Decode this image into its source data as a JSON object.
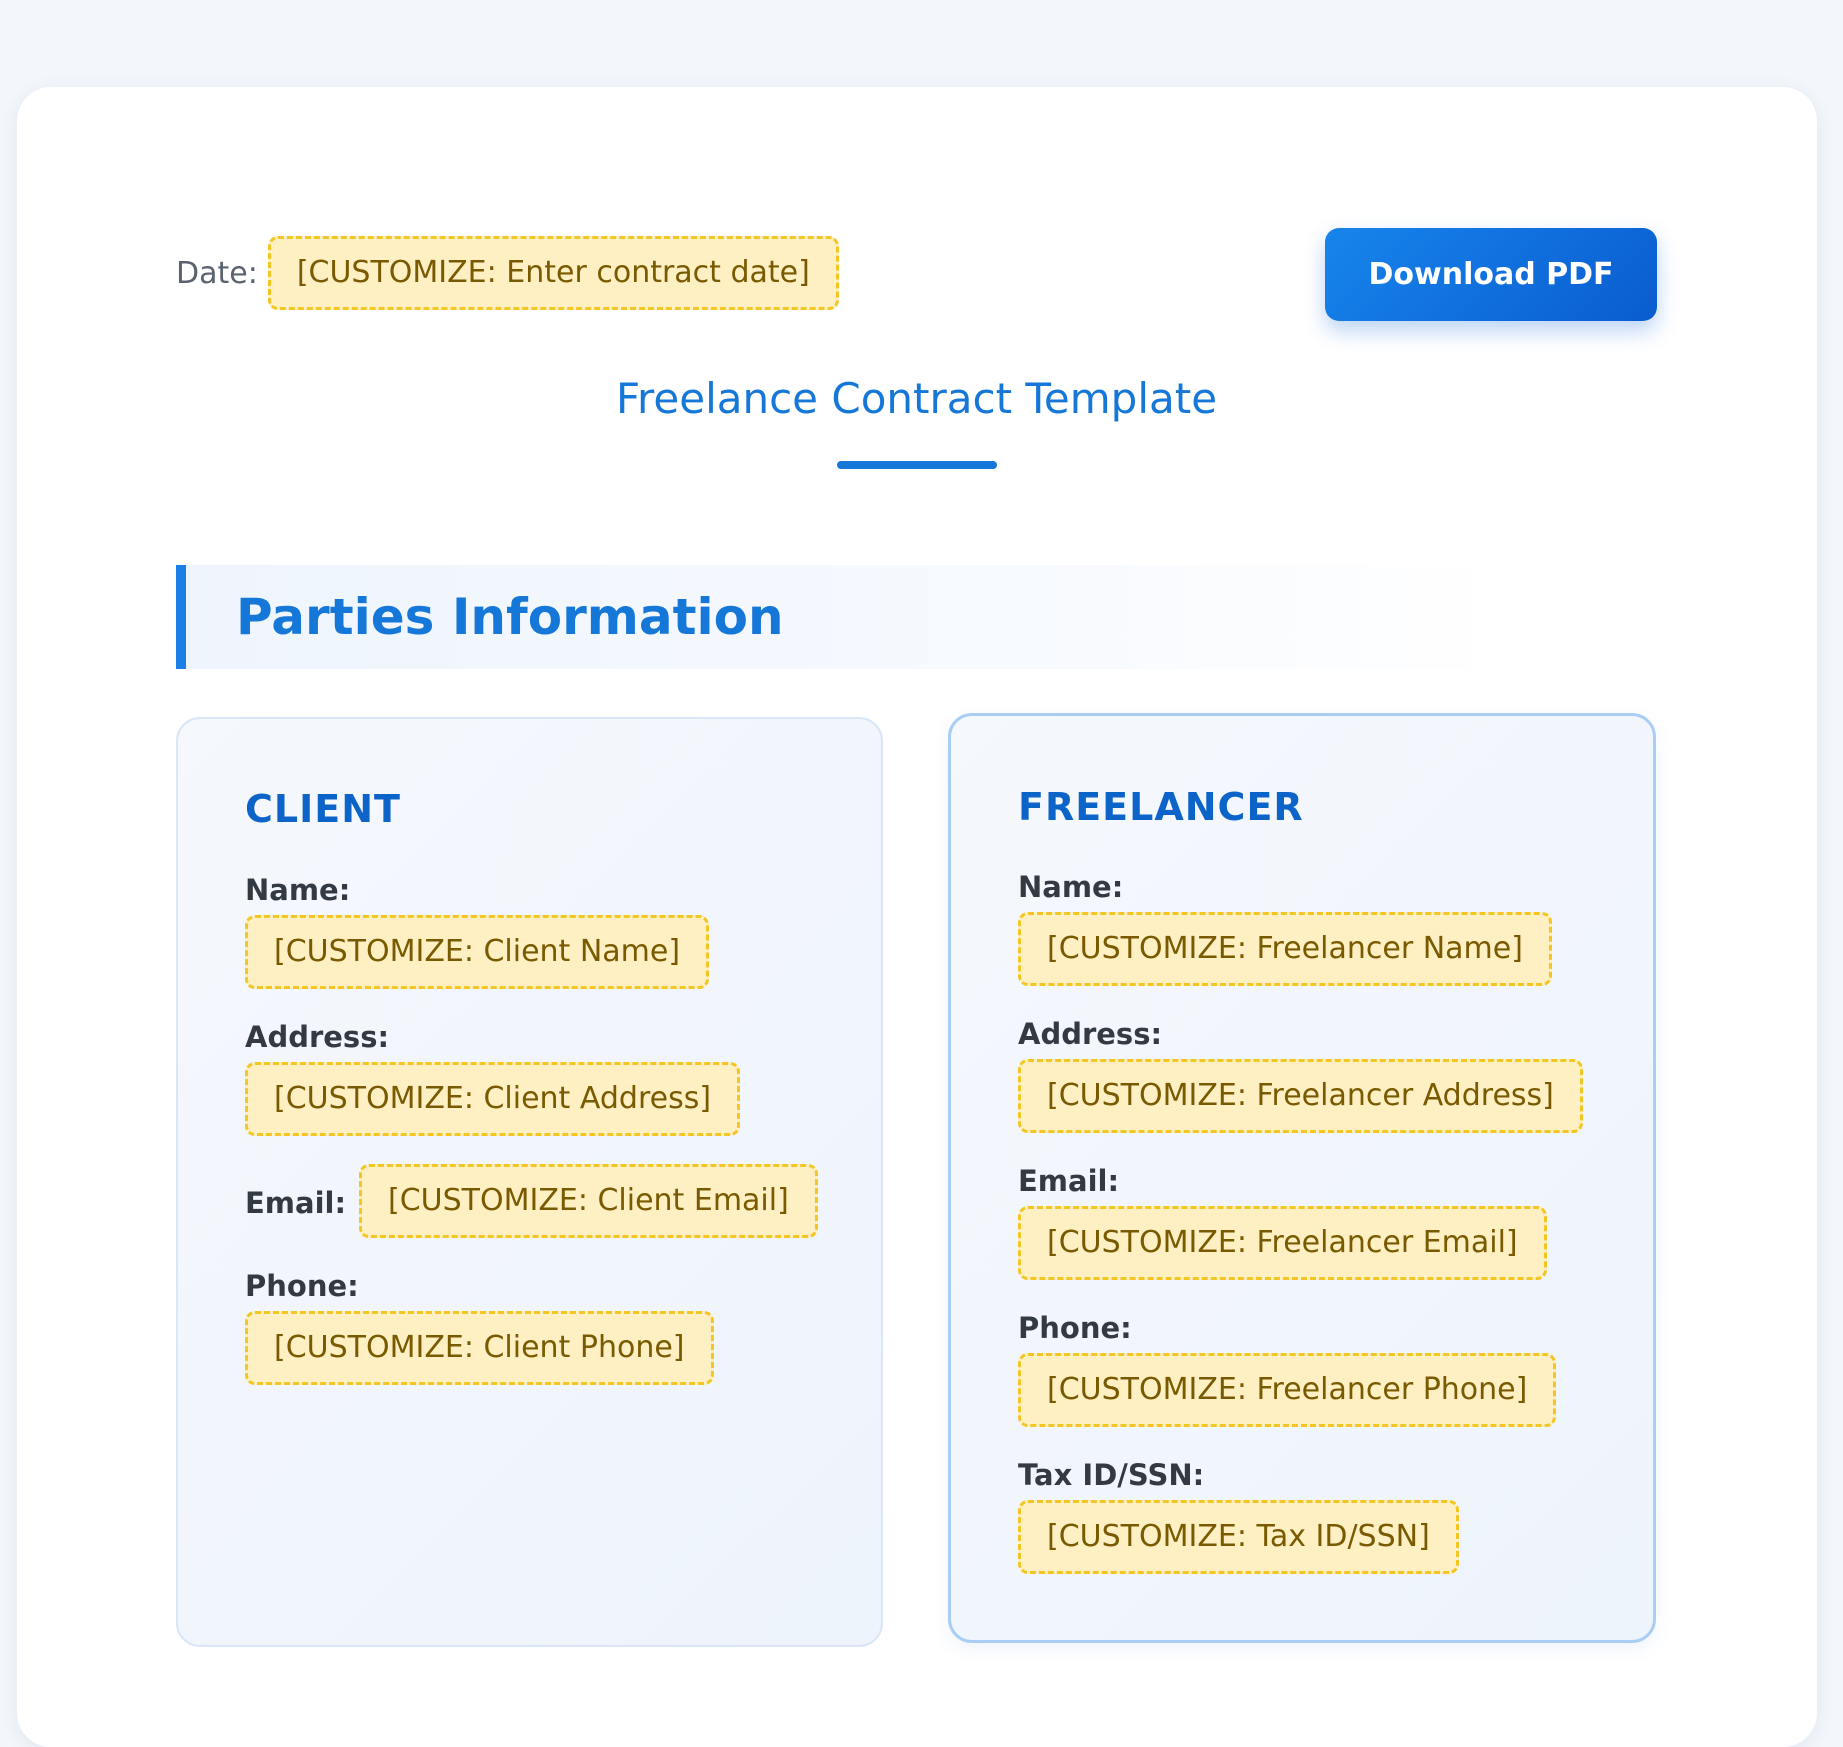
{
  "header": {
    "date_label": "Date:",
    "date_value": "[CUSTOMIZE: Enter contract date]",
    "download_label": "Download PDF"
  },
  "document": {
    "title": "Freelance Contract Template"
  },
  "parties": {
    "section_title": "Parties Information",
    "client": {
      "heading": "CLIENT",
      "name_label": "Name:",
      "name_value": "[CUSTOMIZE: Client Name]",
      "address_label": "Address:",
      "address_value": "[CUSTOMIZE: Client Address]",
      "email_label": "Email:",
      "email_value": "[CUSTOMIZE: Client Email]",
      "phone_label": "Phone:",
      "phone_value": "[CUSTOMIZE: Client Phone]"
    },
    "freelancer": {
      "heading": "FREELANCER",
      "name_label": "Name:",
      "name_value": "[CUSTOMIZE: Freelancer Name]",
      "address_label": "Address:",
      "address_value": "[CUSTOMIZE: Freelancer Address]",
      "email_label": "Email:",
      "email_value": "[CUSTOMIZE: Freelancer Email]",
      "phone_label": "Phone:",
      "phone_value": "[CUSTOMIZE: Freelancer Phone]",
      "taxid_label": "Tax ID/SSN:",
      "taxid_value": "[CUSTOMIZE: Tax ID/SSN]"
    }
  },
  "colors": {
    "accent": "#1577d8",
    "placeholder_bg": "#fff0c4",
    "placeholder_border": "#f3c623",
    "placeholder_text": "#7a5a00"
  }
}
